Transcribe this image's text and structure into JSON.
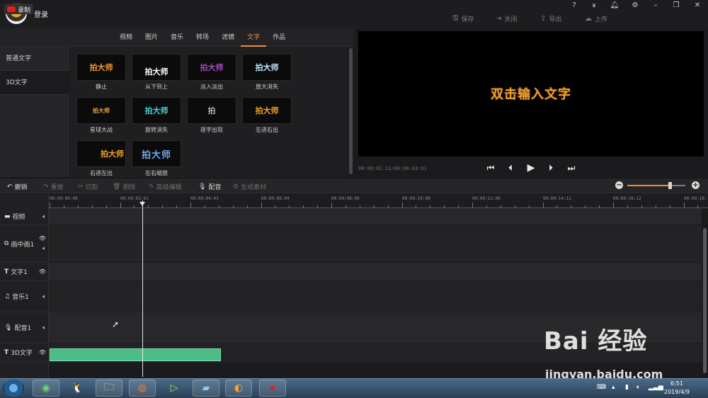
{
  "app": {
    "login_label": "登录",
    "window_controls": [
      "?",
      "VIP",
      "🔔",
      "⚙",
      "–",
      "❐",
      "✕"
    ],
    "top_actions": [
      {
        "label": "保存",
        "icon": "save-icon"
      },
      {
        "label": "关闭",
        "icon": "exit-icon"
      },
      {
        "label": "导出",
        "icon": "export-icon"
      },
      {
        "label": "上传",
        "icon": "upload-icon"
      }
    ]
  },
  "record_button": "录制",
  "tabs": [
    "视频",
    "图片",
    "音乐",
    "转场",
    "滤镜",
    "文字",
    "作品"
  ],
  "active_tab": "文字",
  "sidebar": {
    "items": [
      "普通文字",
      "3D文字"
    ]
  },
  "effects": [
    {
      "thumb_text": "拍大师",
      "label": "静止",
      "color": "#f09a30"
    },
    {
      "thumb_text": "拍大师",
      "label": "从下到上",
      "color": "#ffffff"
    },
    {
      "thumb_text": "拍大师",
      "label": "淡入淡出",
      "color": "#a24fb8"
    },
    {
      "thumb_text": "拍大师",
      "label": "放大消失",
      "color": "#bde8ff"
    },
    {
      "thumb_text": "拍大师",
      "label": "星球大战",
      "color": "#f0a030"
    },
    {
      "thumb_text": "拍大师",
      "label": "旋转消失",
      "color": "#4ad0d0"
    },
    {
      "thumb_text": "拍",
      "label": "逐字出现",
      "color": "#ffffff"
    },
    {
      "thumb_text": "拍大师",
      "label": "左进右出",
      "color": "#f0a030"
    },
    {
      "thumb_text": "拍大师",
      "label": "右进左出",
      "color": "#f0a030"
    },
    {
      "thumb_text": "拍大师",
      "label": "左右缩放",
      "color": "#6aa8e8"
    }
  ],
  "preview": {
    "text": "双击输入文字",
    "time": "00:00:02.22/00:00:03:01",
    "controls": [
      "⏮",
      "⏴",
      "▶",
      "⏵",
      "⏭"
    ]
  },
  "edit_toolbar": [
    {
      "label": "撤销",
      "icon": "undo-icon",
      "enabled": true
    },
    {
      "label": "重做",
      "icon": "redo-icon",
      "enabled": false
    },
    {
      "label": "切割",
      "icon": "scissors-icon",
      "enabled": false
    },
    {
      "label": "删除",
      "icon": "trash-icon",
      "enabled": false
    },
    {
      "label": "高级编辑",
      "icon": "pencil-icon",
      "enabled": false
    },
    {
      "label": "配音",
      "icon": "microphone-icon",
      "enabled": true
    },
    {
      "label": "生成素材",
      "icon": "gear-icon",
      "enabled": false
    }
  ],
  "zoom_level": 0.72,
  "ruler": [
    "00:00:00:00",
    "00:00:02:01",
    "00:00:04:03",
    "00:00:06:04",
    "00:00:08:06",
    "00:00:10:08",
    "00:00:12:09",
    "00:00:14:11",
    "00:00:16:12",
    "00:00:18:"
  ],
  "tracks": [
    {
      "label": "视频",
      "icon": "video-icon"
    },
    {
      "label": "画中画1",
      "icon": "pip-icon"
    },
    {
      "label": "文字1",
      "icon": "text-icon"
    },
    {
      "label": "音乐1",
      "icon": "music-icon"
    },
    {
      "label": "配音1",
      "icon": "microphone-icon"
    },
    {
      "label": "3D文字",
      "icon": "text-icon"
    }
  ],
  "watermark": {
    "brand": "Bai 经验",
    "url": "jingyan.baidu.com"
  },
  "taskbar": {
    "time": "6:51",
    "date": "2019/4/9"
  }
}
